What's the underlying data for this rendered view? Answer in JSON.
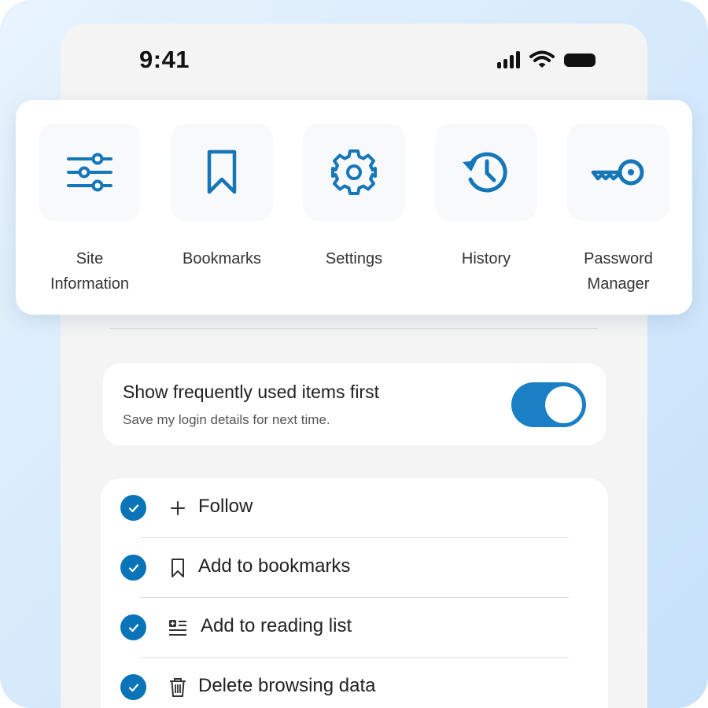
{
  "status_bar": {
    "time": "9:41",
    "icons": [
      "cellular-signal-icon",
      "wifi-icon",
      "battery-icon"
    ]
  },
  "quick_actions": [
    {
      "label": "Site\nInformation",
      "icon": "sliders-icon"
    },
    {
      "label": "Bookmarks",
      "icon": "bookmark-icon"
    },
    {
      "label": "Settings",
      "icon": "gear-icon"
    },
    {
      "label": "History",
      "icon": "history-icon"
    },
    {
      "label": "Password\nManager",
      "icon": "key-icon"
    }
  ],
  "preference": {
    "title": "Show frequently used items first",
    "subtitle": "Save my login details for next time.",
    "enabled": true
  },
  "menu_items": [
    {
      "label": "Follow",
      "icon": "plus-icon",
      "checked": true
    },
    {
      "label": "Add to bookmarks",
      "icon": "bookmark-outline-icon",
      "checked": true
    },
    {
      "label": "Add to reading list",
      "icon": "reading-list-icon",
      "checked": true
    },
    {
      "label": "Delete browsing data",
      "icon": "trash-icon",
      "checked": true
    }
  ],
  "colors": {
    "accent": "#0a74b8",
    "icon_blue": "#1677b8",
    "background_gradient": [
      "#e8f3fd",
      "#c6e1fa"
    ],
    "panel": "#f4f4f4"
  }
}
